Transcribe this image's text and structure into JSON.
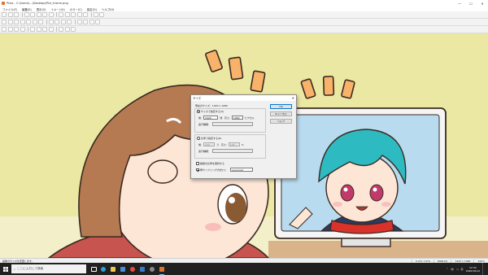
{
  "window": {
    "title": "Pixia - C:\\Users\\...\\Desktop\\Pict_frame.png",
    "controls": [
      "—",
      "☐",
      "✕"
    ]
  },
  "menu": [
    "ファイル(F)",
    "編集(E)",
    "表示(V)",
    "イメージ(I)",
    "カラー(C)",
    "設定(O)",
    "ヘルプ(H)"
  ],
  "dialog": {
    "title": "サイズ",
    "current_size": "現在のサイズ：1920 x 1080",
    "option_pixel": "サイズで指定する(S)",
    "width_label": "幅：",
    "width_value": "1920",
    "height_label": "高さ：",
    "height_value": "1080",
    "unit_pixel": "ピクセル",
    "method_label": "実行種類：",
    "option_percent": "比率で指定する(R)",
    "pct_width_label": "幅：",
    "pct_width_value": "100",
    "pct_height_label": "高さ：",
    "pct_height_value": "100",
    "unit_percent": "%",
    "method_label_2": "実行種類：",
    "keep_ratio_label": "縦横の比率を保持する",
    "resampling_label": "再サンプリング方式(Y)：",
    "resampling_value": "Lanczos3",
    "ok_button": "OK",
    "cancel_button": "キャンセル",
    "help_button": "ヘルプ"
  },
  "statusbar": {
    "message": "画像のサイズを変更します。",
    "coords": "X:211  Y:474",
    "mode": "RGB(24)",
    "size": "1920 x 1080",
    "zoom": "100%"
  },
  "taskbar": {
    "search_placeholder": "ここに入力して検索",
    "tray_lang": "あ",
    "time": "12:34",
    "date": "2020/10/12"
  },
  "colors": {
    "background_yellow": "#ebe8a4",
    "hair_brown": "#b67a52",
    "hair_teal": "#2dbac0",
    "skin": "#fde6d6",
    "sign_orange": "#f9b26a",
    "accent": "#0078d7"
  }
}
